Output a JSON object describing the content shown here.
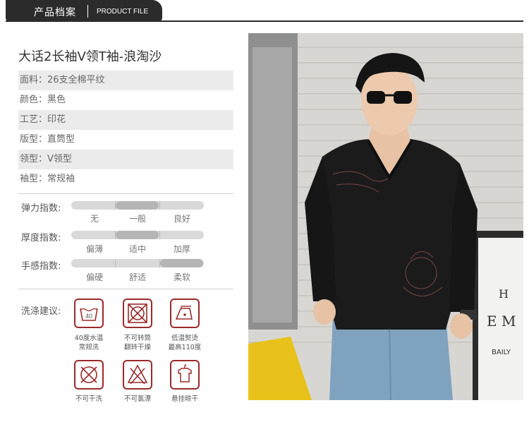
{
  "header": {
    "title_cn": "产品档案",
    "title_en": "PRODUCT FILE"
  },
  "product_title": "大话2长袖V领T袖-浪淘沙",
  "specs": [
    {
      "text": "面料：26支全棉平纹"
    },
    {
      "text": "颜色：黑色"
    },
    {
      "text": "工艺：印花"
    },
    {
      "text": "版型：直筒型"
    },
    {
      "text": "领型：V领型"
    },
    {
      "text": "袖型：常规袖"
    }
  ],
  "scales": [
    {
      "label": "弹力指数:",
      "options": [
        "无",
        "一般",
        "良好"
      ],
      "selected_index": 1
    },
    {
      "label": "厚度指数:",
      "options": [
        "偏薄",
        "适中",
        "加厚"
      ],
      "selected_index": 1
    },
    {
      "label": "手感指数:",
      "options": [
        "偏硬",
        "舒适",
        "柔软"
      ],
      "selected_index": 2
    }
  ],
  "wash": {
    "label": "洗涤建议:",
    "items": [
      {
        "icon": "wash-40-icon",
        "num": "40",
        "line1": "40度水温",
        "line2": "常规洗"
      },
      {
        "icon": "no-tumble-dry-icon",
        "line1": "不可转筒",
        "line2": "翻转干燥"
      },
      {
        "icon": "iron-low-icon",
        "line1": "低温熨烫",
        "line2": "最高110度"
      },
      {
        "icon": "no-dry-clean-icon",
        "line1": "不可干洗",
        "line2": ""
      },
      {
        "icon": "no-bleach-icon",
        "line1": "不可氯漂",
        "line2": ""
      },
      {
        "icon": "hang-dry-icon",
        "line1": "悬挂晾干",
        "line2": ""
      }
    ]
  },
  "photo": {
    "sign_lines": [
      "H",
      "E M",
      "BAILY"
    ]
  },
  "colors": {
    "header_bg": "#2b2b2b",
    "icon_red": "#9a2a2a",
    "shirt": "#1b1b1b",
    "jeans": "#7fa2bf",
    "chair": "#e8c21a"
  }
}
